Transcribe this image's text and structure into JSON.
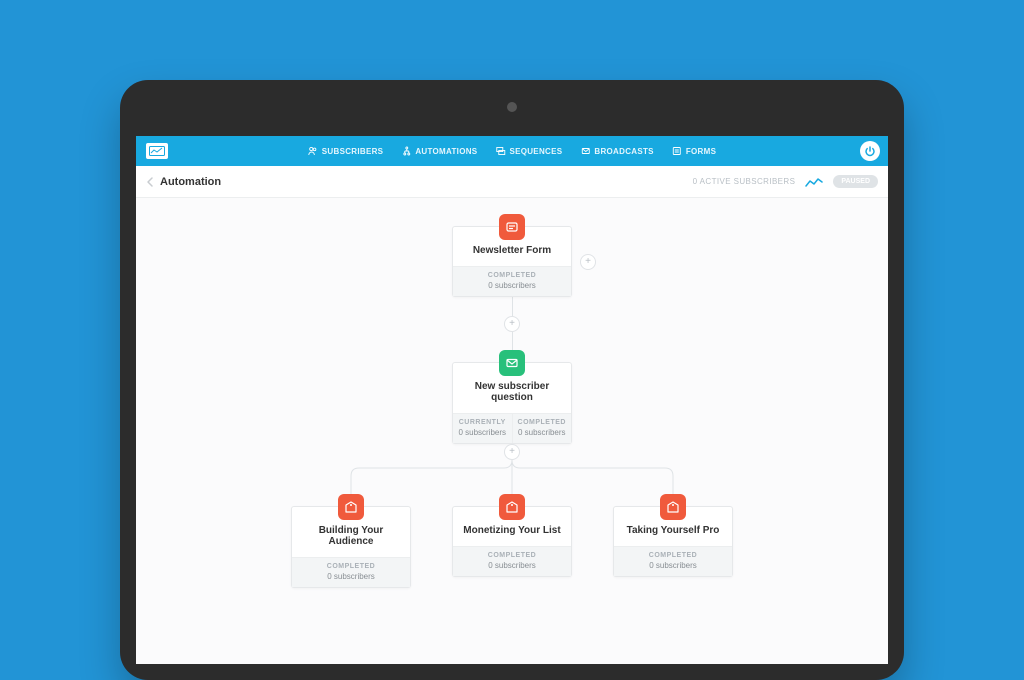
{
  "nav": {
    "items": [
      "SUBSCRIBERS",
      "AUTOMATIONS",
      "SEQUENCES",
      "BROADCASTS",
      "FORMS"
    ]
  },
  "subheader": {
    "back_label": "Automation",
    "active_label": "0 ACTIVE SUBSCRIBERS",
    "status_pill": "PAUSED"
  },
  "labels": {
    "completed": "COMPLETED",
    "currently": "CURRENTLY",
    "zero_subscribers": "0 subscribers"
  },
  "nodes": {
    "form": {
      "title": "Newsletter Form"
    },
    "question": {
      "title": "New subscriber question"
    },
    "branch_a": {
      "title": "Building Your Audience"
    },
    "branch_b": {
      "title": "Monetizing Your List"
    },
    "branch_c": {
      "title": "Taking Yourself Pro"
    }
  }
}
